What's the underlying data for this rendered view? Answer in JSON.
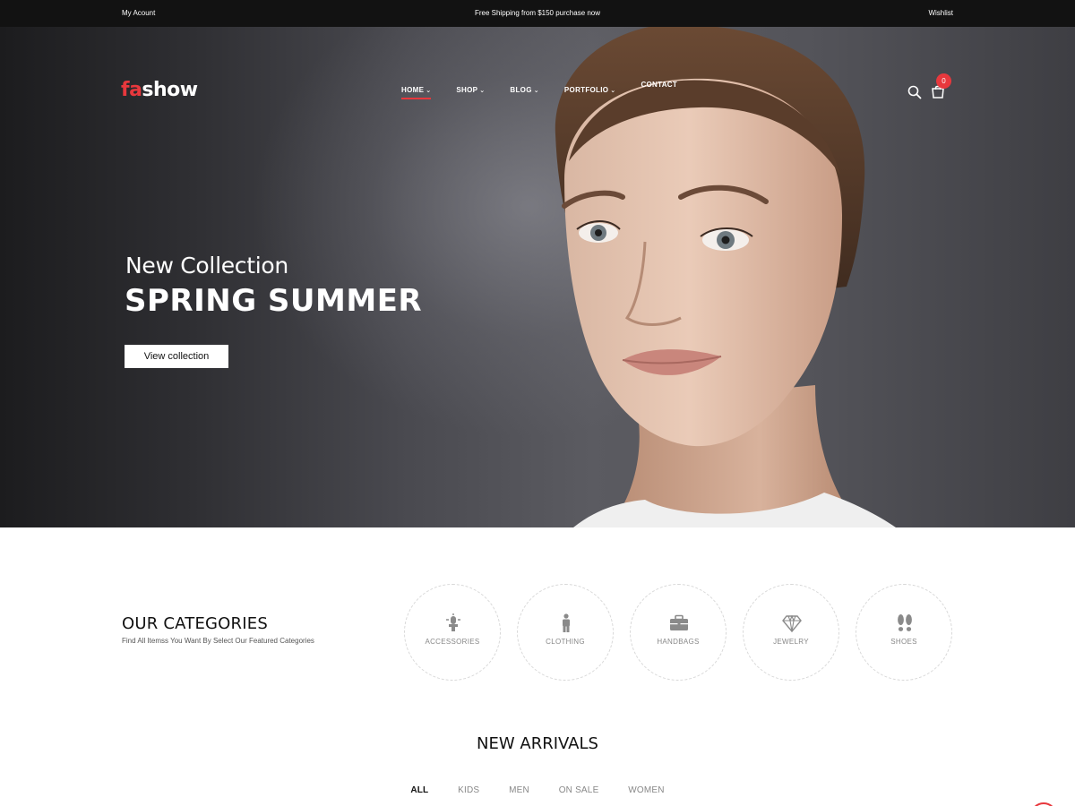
{
  "topbar": {
    "account": "My Acount",
    "promo": "Free Shipping from $150 purchase now",
    "wishlist": "Wishlist"
  },
  "header": {
    "logo_prefix": "fa",
    "logo_suffix": "show",
    "nav": [
      {
        "label": "HOME",
        "has_dropdown": true,
        "active": true
      },
      {
        "label": "SHOP",
        "has_dropdown": true,
        "active": false
      },
      {
        "label": "BLOG",
        "has_dropdown": true,
        "active": false
      },
      {
        "label": "PORTFOLIO",
        "has_dropdown": true,
        "active": false
      },
      {
        "label": "CONTACT",
        "has_dropdown": false,
        "active": false
      }
    ],
    "cart_count": "0",
    "icons": {
      "search": "search-icon",
      "cart": "shopping-bag-icon"
    }
  },
  "hero": {
    "subtitle": "New Collection",
    "title": "SPRING SUMMER",
    "button": "View collection",
    "slides": 3,
    "active_slide": 1
  },
  "categories": {
    "title": "OUR CATEGORIES",
    "description": "Find All Itemss You Want By Select Our Featured Categories",
    "items": [
      {
        "label": "ACCESSORIES",
        "icon": "lamp-icon"
      },
      {
        "label": "CLOTHING",
        "icon": "person-icon"
      },
      {
        "label": "HANDBAGS",
        "icon": "briefcase-icon"
      },
      {
        "label": "JEWELRY",
        "icon": "diamond-icon"
      },
      {
        "label": "SHOES",
        "icon": "footprints-icon"
      }
    ]
  },
  "new_arrivals": {
    "title": "NEW ARRIVALS",
    "filters": [
      "ALL",
      "KIDS",
      "MEN",
      "ON SALE",
      "WOMEN"
    ],
    "active_filter": "ALL"
  },
  "colors": {
    "accent": "#e8383d",
    "topbar": "#121212"
  }
}
